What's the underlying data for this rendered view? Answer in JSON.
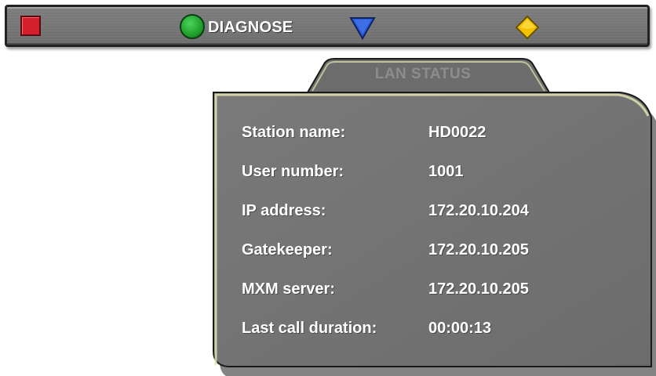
{
  "toolbar": {
    "title": "DIAGNOSE",
    "buttons": [
      {
        "color": "#d4202c",
        "icon": "red-square-icon"
      },
      {
        "color": "#22a532",
        "icon": "green-circle-icon"
      },
      {
        "color": "#2a5ad8",
        "icon": "blue-triangle-icon"
      },
      {
        "color": "#f0c000",
        "icon": "yellow-diamond-icon"
      }
    ]
  },
  "panel": {
    "tab_title": "LAN STATUS",
    "rows": [
      {
        "label": "Station name:",
        "value": "HD0022"
      },
      {
        "label": "User number:",
        "value": "1001"
      },
      {
        "label": "IP address:",
        "value": "172.20.10.204"
      },
      {
        "label": "Gatekeeper:",
        "value": "172.20.10.205"
      },
      {
        "label": "MXM server:",
        "value": "172.20.10.205"
      },
      {
        "label": "Last call duration:",
        "value": "00:00:13"
      }
    ]
  }
}
